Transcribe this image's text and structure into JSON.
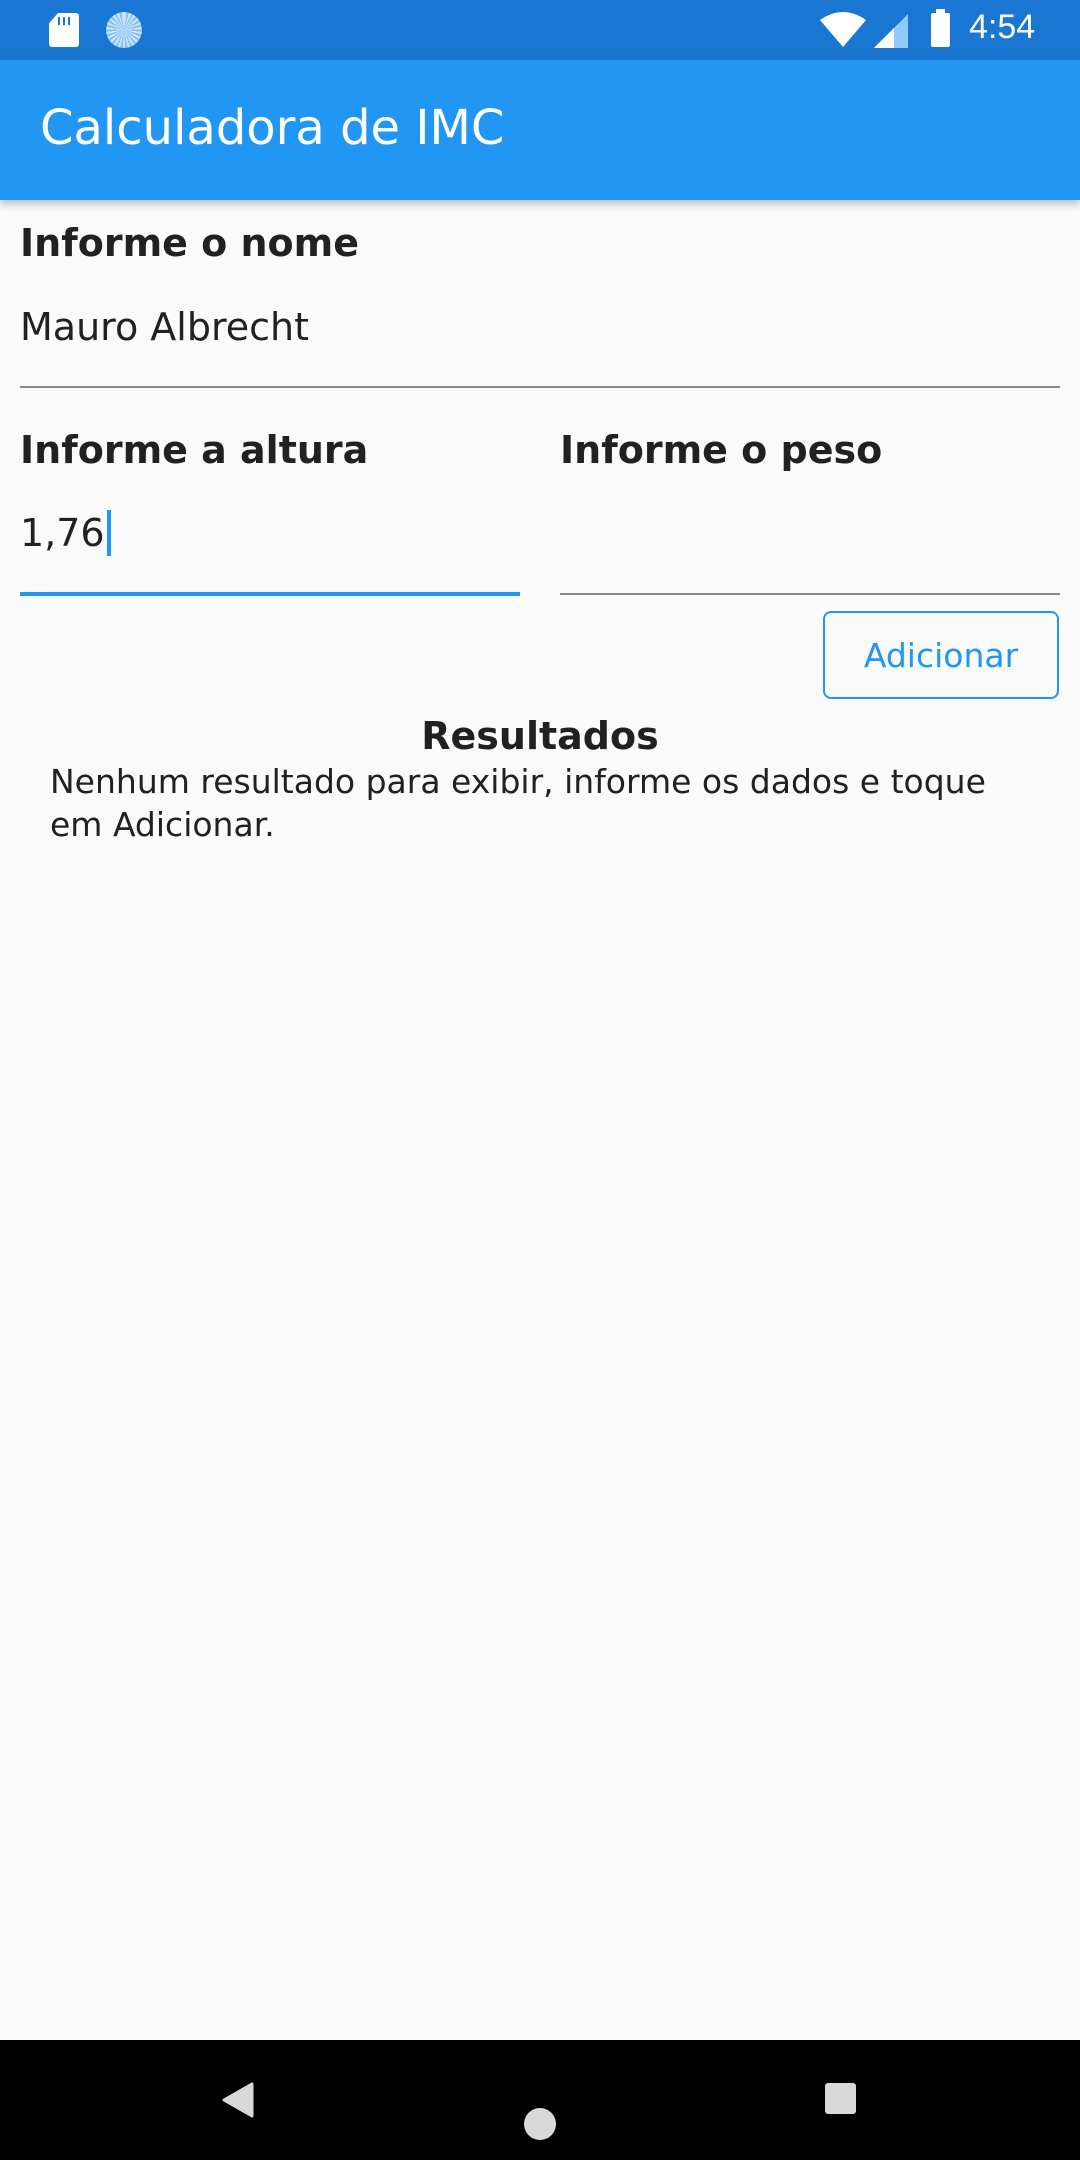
{
  "status_bar": {
    "time": "4:54",
    "icons": [
      "sd-card-icon",
      "sync-icon",
      "wifi-icon",
      "signal-icon",
      "battery-icon"
    ]
  },
  "app_bar": {
    "title": "Calculadora de IMC",
    "color": "#2196f3"
  },
  "form": {
    "name": {
      "label": "Informe o nome",
      "value": "Mauro Albrecht"
    },
    "height": {
      "label": "Informe a altura",
      "value": "1,76",
      "focused": true
    },
    "weight": {
      "label": "Informe o peso",
      "value": ""
    },
    "add_button": "Adicionar"
  },
  "results": {
    "title": "Resultados",
    "message": "Nenhum resultado para exibir, informe os dados e toque em Adicionar."
  },
  "nav_bar": {
    "icons": [
      "back-icon",
      "home-icon",
      "recents-icon"
    ]
  }
}
